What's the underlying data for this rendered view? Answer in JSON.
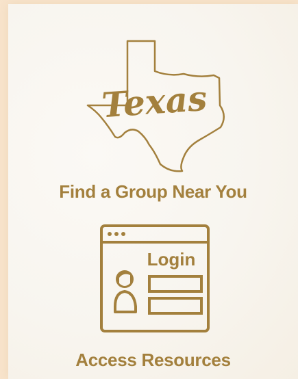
{
  "brand": {
    "accent_color": "#a3803d",
    "background_color": "#f8e4cc"
  },
  "links": [
    {
      "icon": "texas-map-icon",
      "icon_text": "Texas",
      "label": "Find a Group Near You"
    },
    {
      "icon": "login-window-icon",
      "icon_text": "Login",
      "label": "Access Resources"
    }
  ]
}
